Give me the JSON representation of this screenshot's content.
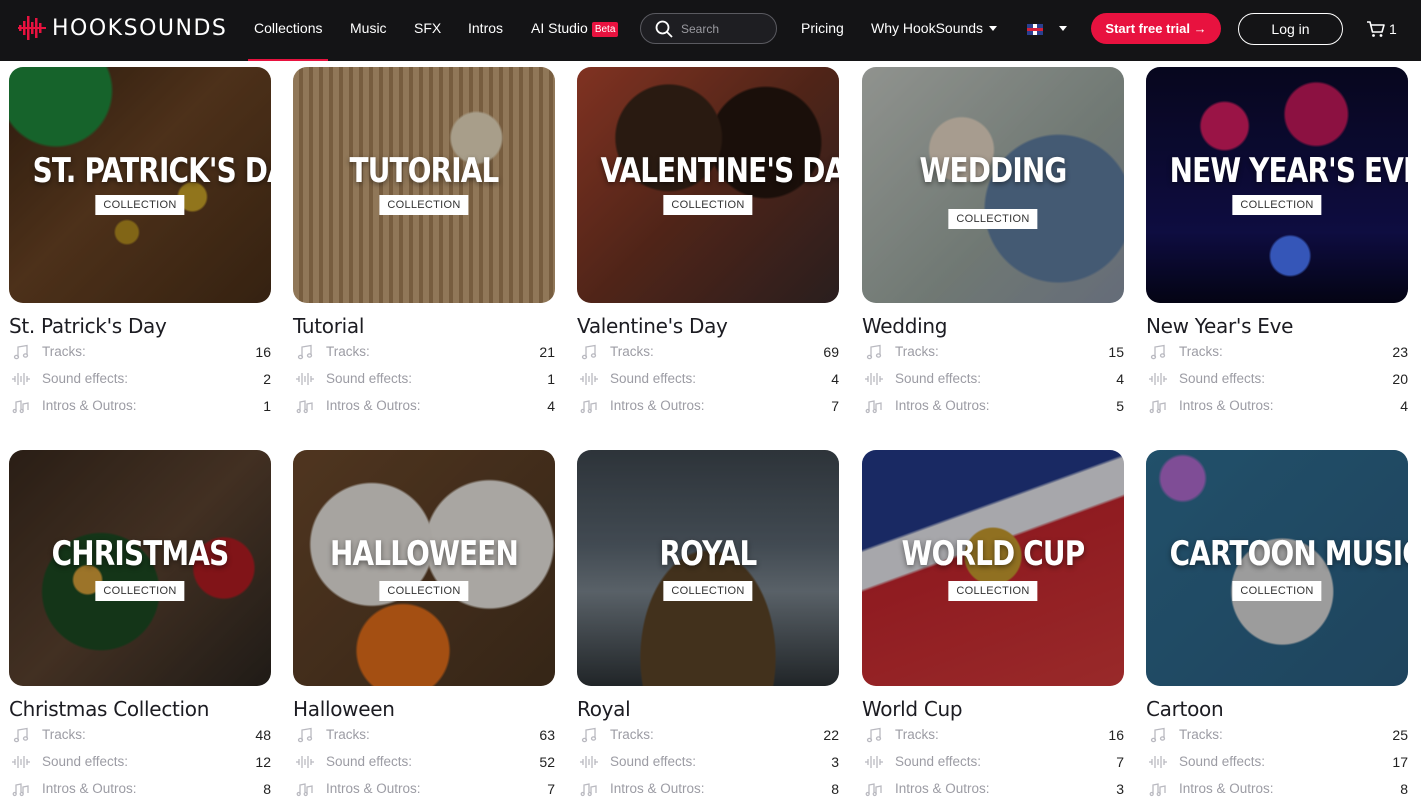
{
  "brand": {
    "name": "HOOKSOUNDS",
    "accent": "#e8123f",
    "nav_bg": "#141416"
  },
  "nav": {
    "collections": "Collections",
    "music": "Music",
    "sfx": "SFX",
    "intros": "Intros",
    "ai_studio": "AI Studio",
    "beta": "Beta",
    "search_placeholder": "Search",
    "pricing": "Pricing",
    "why": "Why HookSounds",
    "language_icon": "uk-flag-icon",
    "trial": "Start free trial →",
    "login": "Log in",
    "cart_count": "1"
  },
  "labels": {
    "tracks": "Tracks:",
    "sfx": "Sound effects:",
    "intros": "Intros & Outros:",
    "badge": "COLLECTION"
  },
  "cards": [
    {
      "overlay": "ST. PATRICK'S DAY",
      "name": "St. Patrick's Day",
      "tracks": "16",
      "sfx": "2",
      "intros": "1"
    },
    {
      "overlay": "TUTORIAL",
      "name": "Tutorial",
      "tracks": "21",
      "sfx": "1",
      "intros": "4"
    },
    {
      "overlay": "VALENTINE'S DAY",
      "name": "Valentine's Day",
      "tracks": "69",
      "sfx": "4",
      "intros": "7"
    },
    {
      "overlay": "WEDDING",
      "name": "Wedding",
      "tracks": "15",
      "sfx": "4",
      "intros": "5"
    },
    {
      "overlay": "NEW YEAR'S EVE",
      "name": "New Year's Eve",
      "tracks": "23",
      "sfx": "20",
      "intros": "4"
    },
    {
      "overlay": "CHRISTMAS",
      "name": "Christmas Collection",
      "tracks": "48",
      "sfx": "12",
      "intros": "8"
    },
    {
      "overlay": "HALLOWEEN",
      "name": "Halloween",
      "tracks": "63",
      "sfx": "52",
      "intros": "7"
    },
    {
      "overlay": "ROYAL",
      "name": "Royal",
      "tracks": "22",
      "sfx": "3",
      "intros": "8"
    },
    {
      "overlay": "WORLD CUP",
      "name": "World Cup",
      "tracks": "16",
      "sfx": "7",
      "intros": "3"
    },
    {
      "overlay": "CARTOON MUSIC",
      "name": "Cartoon",
      "tracks": "25",
      "sfx": "17",
      "intros": "8"
    }
  ]
}
